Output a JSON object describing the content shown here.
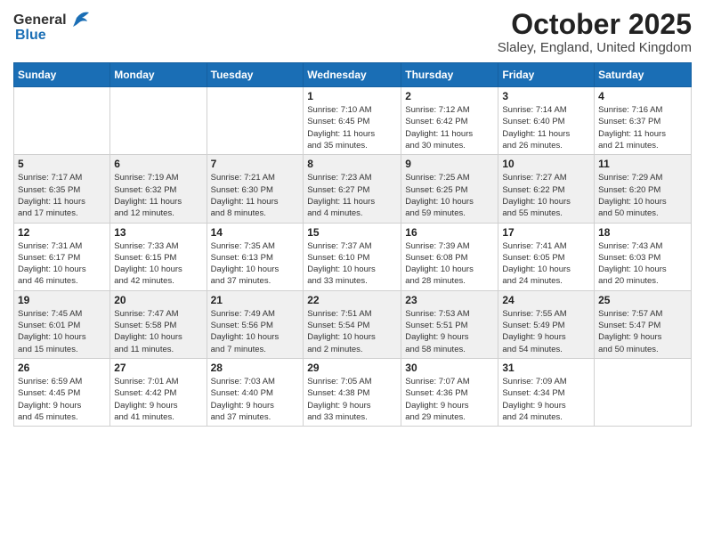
{
  "header": {
    "logo_general": "General",
    "logo_blue": "Blue",
    "month": "October 2025",
    "location": "Slaley, England, United Kingdom"
  },
  "weekdays": [
    "Sunday",
    "Monday",
    "Tuesday",
    "Wednesday",
    "Thursday",
    "Friday",
    "Saturday"
  ],
  "weeks": [
    [
      {
        "day": "",
        "info": ""
      },
      {
        "day": "",
        "info": ""
      },
      {
        "day": "",
        "info": ""
      },
      {
        "day": "1",
        "info": "Sunrise: 7:10 AM\nSunset: 6:45 PM\nDaylight: 11 hours\nand 35 minutes."
      },
      {
        "day": "2",
        "info": "Sunrise: 7:12 AM\nSunset: 6:42 PM\nDaylight: 11 hours\nand 30 minutes."
      },
      {
        "day": "3",
        "info": "Sunrise: 7:14 AM\nSunset: 6:40 PM\nDaylight: 11 hours\nand 26 minutes."
      },
      {
        "day": "4",
        "info": "Sunrise: 7:16 AM\nSunset: 6:37 PM\nDaylight: 11 hours\nand 21 minutes."
      }
    ],
    [
      {
        "day": "5",
        "info": "Sunrise: 7:17 AM\nSunset: 6:35 PM\nDaylight: 11 hours\nand 17 minutes."
      },
      {
        "day": "6",
        "info": "Sunrise: 7:19 AM\nSunset: 6:32 PM\nDaylight: 11 hours\nand 12 minutes."
      },
      {
        "day": "7",
        "info": "Sunrise: 7:21 AM\nSunset: 6:30 PM\nDaylight: 11 hours\nand 8 minutes."
      },
      {
        "day": "8",
        "info": "Sunrise: 7:23 AM\nSunset: 6:27 PM\nDaylight: 11 hours\nand 4 minutes."
      },
      {
        "day": "9",
        "info": "Sunrise: 7:25 AM\nSunset: 6:25 PM\nDaylight: 10 hours\nand 59 minutes."
      },
      {
        "day": "10",
        "info": "Sunrise: 7:27 AM\nSunset: 6:22 PM\nDaylight: 10 hours\nand 55 minutes."
      },
      {
        "day": "11",
        "info": "Sunrise: 7:29 AM\nSunset: 6:20 PM\nDaylight: 10 hours\nand 50 minutes."
      }
    ],
    [
      {
        "day": "12",
        "info": "Sunrise: 7:31 AM\nSunset: 6:17 PM\nDaylight: 10 hours\nand 46 minutes."
      },
      {
        "day": "13",
        "info": "Sunrise: 7:33 AM\nSunset: 6:15 PM\nDaylight: 10 hours\nand 42 minutes."
      },
      {
        "day": "14",
        "info": "Sunrise: 7:35 AM\nSunset: 6:13 PM\nDaylight: 10 hours\nand 37 minutes."
      },
      {
        "day": "15",
        "info": "Sunrise: 7:37 AM\nSunset: 6:10 PM\nDaylight: 10 hours\nand 33 minutes."
      },
      {
        "day": "16",
        "info": "Sunrise: 7:39 AM\nSunset: 6:08 PM\nDaylight: 10 hours\nand 28 minutes."
      },
      {
        "day": "17",
        "info": "Sunrise: 7:41 AM\nSunset: 6:05 PM\nDaylight: 10 hours\nand 24 minutes."
      },
      {
        "day": "18",
        "info": "Sunrise: 7:43 AM\nSunset: 6:03 PM\nDaylight: 10 hours\nand 20 minutes."
      }
    ],
    [
      {
        "day": "19",
        "info": "Sunrise: 7:45 AM\nSunset: 6:01 PM\nDaylight: 10 hours\nand 15 minutes."
      },
      {
        "day": "20",
        "info": "Sunrise: 7:47 AM\nSunset: 5:58 PM\nDaylight: 10 hours\nand 11 minutes."
      },
      {
        "day": "21",
        "info": "Sunrise: 7:49 AM\nSunset: 5:56 PM\nDaylight: 10 hours\nand 7 minutes."
      },
      {
        "day": "22",
        "info": "Sunrise: 7:51 AM\nSunset: 5:54 PM\nDaylight: 10 hours\nand 2 minutes."
      },
      {
        "day": "23",
        "info": "Sunrise: 7:53 AM\nSunset: 5:51 PM\nDaylight: 9 hours\nand 58 minutes."
      },
      {
        "day": "24",
        "info": "Sunrise: 7:55 AM\nSunset: 5:49 PM\nDaylight: 9 hours\nand 54 minutes."
      },
      {
        "day": "25",
        "info": "Sunrise: 7:57 AM\nSunset: 5:47 PM\nDaylight: 9 hours\nand 50 minutes."
      }
    ],
    [
      {
        "day": "26",
        "info": "Sunrise: 6:59 AM\nSunset: 4:45 PM\nDaylight: 9 hours\nand 45 minutes."
      },
      {
        "day": "27",
        "info": "Sunrise: 7:01 AM\nSunset: 4:42 PM\nDaylight: 9 hours\nand 41 minutes."
      },
      {
        "day": "28",
        "info": "Sunrise: 7:03 AM\nSunset: 4:40 PM\nDaylight: 9 hours\nand 37 minutes."
      },
      {
        "day": "29",
        "info": "Sunrise: 7:05 AM\nSunset: 4:38 PM\nDaylight: 9 hours\nand 33 minutes."
      },
      {
        "day": "30",
        "info": "Sunrise: 7:07 AM\nSunset: 4:36 PM\nDaylight: 9 hours\nand 29 minutes."
      },
      {
        "day": "31",
        "info": "Sunrise: 7:09 AM\nSunset: 4:34 PM\nDaylight: 9 hours\nand 24 minutes."
      },
      {
        "day": "",
        "info": ""
      }
    ]
  ]
}
